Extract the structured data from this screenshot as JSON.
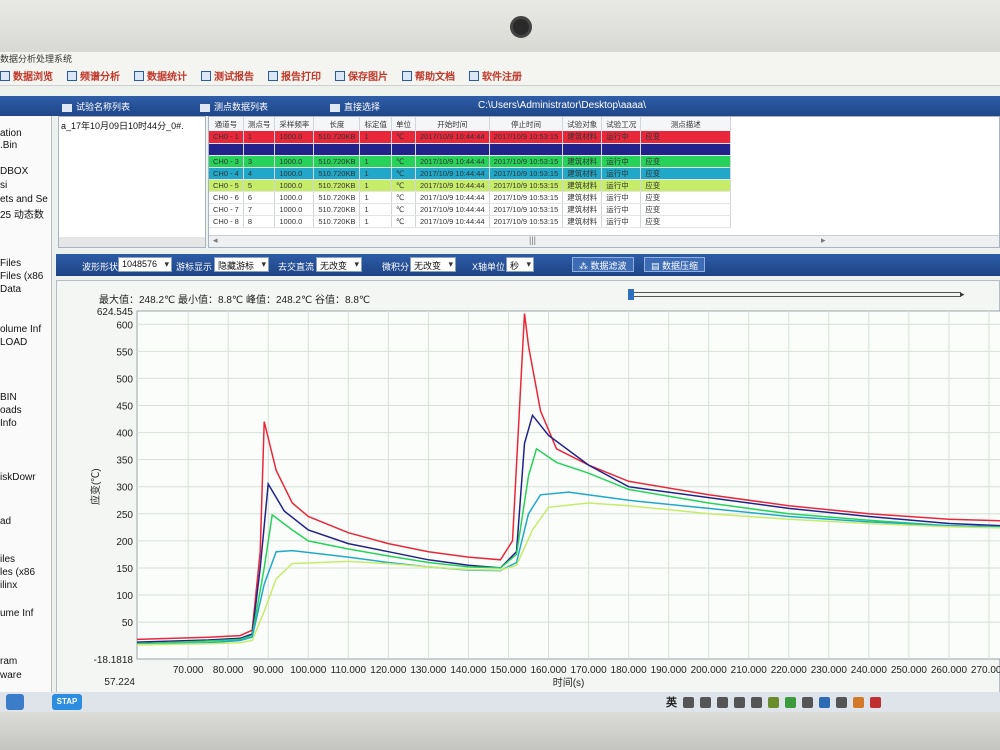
{
  "window": {
    "app_title": "数据分析处理系统",
    "menu": [
      {
        "label": "数据浏览",
        "icon": "chart-icon"
      },
      {
        "label": "频谱分析",
        "icon": "spectrum-icon"
      },
      {
        "label": "数据统计",
        "icon": "stats-icon"
      },
      {
        "label": "测试报告",
        "icon": "report-icon"
      },
      {
        "label": "报告打印",
        "icon": "print-icon"
      },
      {
        "label": "保存图片",
        "icon": "save-image-icon"
      },
      {
        "label": "帮助文档",
        "icon": "help-icon"
      },
      {
        "label": "软件注册",
        "icon": "register-icon"
      }
    ],
    "tabs": [
      {
        "label": "试验名称列表",
        "icon": "list-icon"
      },
      {
        "label": "测点数据列表",
        "icon": "table-icon"
      },
      {
        "label": "直接选择",
        "icon": "select-icon"
      }
    ],
    "path": "C:\\Users\\Administrator\\Desktop\\aaaa\\"
  },
  "explorer": {
    "items": [
      "ation",
      ".Bin",
      "DBOX",
      "si",
      "ets and Se",
      "25 动态数",
      "Files",
      "Files (x86",
      "Data",
      "olume Inf",
      "LOAD",
      "BIN",
      "oads",
      "Info",
      "iskDowr",
      "ad",
      "iles",
      "les (x86",
      "ilinx",
      "ume Inf",
      "ram",
      "ware"
    ]
  },
  "test_list": {
    "items": [
      "a_17年10月09日10时44分_0#."
    ]
  },
  "channel_table": {
    "headers": [
      "通道号",
      "测点号",
      "采样频率",
      "长度",
      "标定值",
      "单位",
      "开始时间",
      "停止时间",
      "试验对象",
      "试验工况",
      "测点描述"
    ],
    "rows": [
      {
        "ch": "CH0 - 1",
        "point": "1",
        "rate": "1000.0",
        "len": "510.720KB",
        "cal": "1",
        "unit": "℃",
        "start": "2017/10/9 10:44:44",
        "stop": "2017/10/9 10:53:15",
        "obj": "建筑材料",
        "cond": "运行中",
        "desc": "应变",
        "color": "#e8283a"
      },
      {
        "ch": "",
        "point": "",
        "rate": "",
        "len": "",
        "cal": "",
        "unit": "",
        "start": "",
        "stop": "",
        "obj": "",
        "cond": "",
        "desc": "",
        "color": "#22238a"
      },
      {
        "ch": "CH0 - 3",
        "point": "3",
        "rate": "1000.0",
        "len": "510.720KB",
        "cal": "1",
        "unit": "℃",
        "start": "2017/10/9 10:44:44",
        "stop": "2017/10/9 10:53:15",
        "obj": "建筑材料",
        "cond": "运行中",
        "desc": "应变",
        "color": "#27d25a"
      },
      {
        "ch": "CH0 - 4",
        "point": "4",
        "rate": "1000.0",
        "len": "510.720KB",
        "cal": "1",
        "unit": "℃",
        "start": "2017/10/9 10:44:44",
        "stop": "2017/10/9 10:53:15",
        "obj": "建筑材料",
        "cond": "运行中",
        "desc": "应变",
        "color": "#21a8c9"
      },
      {
        "ch": "CH0 - 5",
        "point": "5",
        "rate": "1000.0",
        "len": "510.720KB",
        "cal": "1",
        "unit": "℃",
        "start": "2017/10/9 10:44:44",
        "stop": "2017/10/9 10:53:15",
        "obj": "建筑材料",
        "cond": "运行中",
        "desc": "应变",
        "color": "#c6ec6a"
      },
      {
        "ch": "CH0 - 6",
        "point": "6",
        "rate": "1000.0",
        "len": "510.720KB",
        "cal": "1",
        "unit": "℃",
        "start": "2017/10/9 10:44:44",
        "stop": "2017/10/9 10:53:15",
        "obj": "建筑材料",
        "cond": "运行中",
        "desc": "应变",
        "color": ""
      },
      {
        "ch": "CH0 - 7",
        "point": "7",
        "rate": "1000.0",
        "len": "510.720KB",
        "cal": "1",
        "unit": "℃",
        "start": "2017/10/9 10:44:44",
        "stop": "2017/10/9 10:53:15",
        "obj": "建筑材料",
        "cond": "运行中",
        "desc": "应变",
        "color": ""
      },
      {
        "ch": "CH0 - 8",
        "point": "8",
        "rate": "1000.0",
        "len": "510.720KB",
        "cal": "1",
        "unit": "℃",
        "start": "2017/10/9 10:44:44",
        "stop": "2017/10/9 10:53:15",
        "obj": "建筑材料",
        "cond": "运行中",
        "desc": "应变",
        "color": ""
      }
    ]
  },
  "toolbar": {
    "waveform_label": "波形形状",
    "waveform_value": "1048576",
    "cursor_label": "游标显示",
    "cursor_value": "隐藏游标",
    "dc_label": "去交直流",
    "dc_value": "无改变",
    "integral_label": "微积分",
    "integral_value": "无改变",
    "xunit_label": "X轴单位",
    "xunit_value": "秒",
    "filter_button": "数据滤波",
    "compress_button": "数据压缩"
  },
  "stats": {
    "text": "最大值：248.2℃  最小值：8.8℃  峰值：248.2℃  谷值：8.8℃"
  },
  "chart_data": {
    "type": "line",
    "xlabel": "时间(s)",
    "ylabel": "应变(℃)",
    "y_top_label": "624.545",
    "y_bottom_label": "-18.1818",
    "x_first_label": "57.224",
    "xlim": [
      57.224,
      273
    ],
    "ylim": [
      -18.1818,
      624.545
    ],
    "yticks": [
      50,
      100,
      150,
      200,
      250,
      300,
      350,
      400,
      450,
      500,
      550,
      600
    ],
    "yticklabels": [
      "50",
      "100",
      "150",
      "200",
      "250",
      "300",
      "350",
      "400",
      "450",
      "500",
      "550",
      "600"
    ],
    "xticks": [
      70,
      80,
      90,
      100,
      110,
      120,
      130,
      140,
      150,
      160,
      170,
      180,
      190,
      200,
      210,
      220,
      230,
      240,
      250,
      260,
      270
    ],
    "xticklabels": [
      "70.000",
      "80.000",
      "90.000",
      "100.000",
      "110.000",
      "120.000",
      "130.000",
      "140.000",
      "150.000",
      "160.000",
      "170.000",
      "180.000",
      "190.000",
      "200.000",
      "210.000",
      "220.000",
      "230.000",
      "240.000",
      "250.000",
      "260.000",
      "270.000"
    ],
    "grid": true,
    "series": [
      {
        "color": "#e8283a",
        "x": [
          57.224,
          75,
          83,
          86,
          88,
          89,
          92,
          96,
          100,
          110,
          120,
          130,
          140,
          148,
          151,
          153,
          154,
          155,
          158,
          162,
          170,
          180,
          200,
          220,
          240,
          260,
          273
        ],
        "y": [
          18,
          22,
          25,
          35,
          180,
          420,
          330,
          270,
          245,
          215,
          195,
          180,
          170,
          165,
          200,
          480,
          620,
          560,
          440,
          370,
          340,
          310,
          285,
          265,
          250,
          240,
          237
        ]
      },
      {
        "color": "#22238a",
        "x": [
          57.224,
          75,
          83,
          86,
          88,
          90,
          94,
          100,
          110,
          120,
          130,
          140,
          148,
          152,
          154,
          156,
          160,
          170,
          180,
          200,
          220,
          240,
          260,
          273
        ],
        "y": [
          13,
          17,
          20,
          28,
          150,
          305,
          255,
          220,
          195,
          180,
          165,
          155,
          150,
          180,
          380,
          432,
          395,
          340,
          300,
          280,
          260,
          245,
          232,
          228
        ]
      },
      {
        "color": "#27d25a",
        "x": [
          57.224,
          75,
          83,
          86,
          89,
          91,
          96,
          100,
          110,
          120,
          130,
          140,
          148,
          152,
          155,
          157,
          162,
          170,
          180,
          200,
          220,
          240,
          260,
          273
        ],
        "y": [
          10,
          15,
          18,
          25,
          150,
          248,
          220,
          200,
          185,
          172,
          160,
          152,
          150,
          175,
          320,
          370,
          345,
          325,
          295,
          270,
          250,
          238,
          228,
          225
        ]
      },
      {
        "color": "#21a8c9",
        "x": [
          57.224,
          75,
          83,
          86,
          89,
          92,
          96,
          110,
          120,
          130,
          140,
          148,
          152,
          155,
          158,
          165,
          180,
          200,
          220,
          240,
          260,
          273
        ],
        "y": [
          8,
          12,
          16,
          22,
          120,
          180,
          182,
          170,
          160,
          152,
          146,
          145,
          160,
          250,
          285,
          290,
          275,
          260,
          245,
          235,
          228,
          226
        ]
      },
      {
        "color": "#c6ec6a",
        "x": [
          57.224,
          75,
          83,
          86,
          89,
          92,
          96,
          110,
          120,
          130,
          140,
          148,
          152,
          156,
          160,
          170,
          180,
          200,
          220,
          240,
          260,
          273
        ],
        "y": [
          8,
          10,
          12,
          16,
          70,
          130,
          158,
          162,
          158,
          152,
          147,
          146,
          155,
          220,
          262,
          270,
          265,
          250,
          240,
          232,
          226,
          224
        ]
      }
    ]
  },
  "taskbar": {
    "stap_label": "STAP",
    "ime_label": "英"
  }
}
